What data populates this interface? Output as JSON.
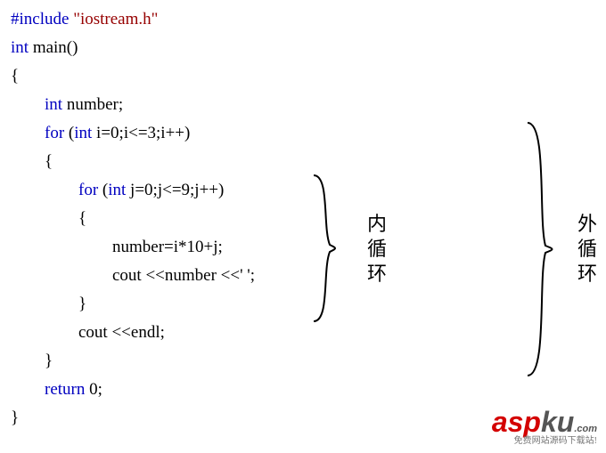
{
  "code": {
    "l1_pp": "#include",
    "l1_str": " \"iostream.h\"",
    "l2_kw": "int",
    "l2_txt": " main()",
    "l3": "{",
    "l4_kw": "int",
    "l4_txt": " number;",
    "l5_kw1": "for",
    "l5_txt1": " (",
    "l5_kw2": "int",
    "l5_txt2": " i=0;i<=3;i++)",
    "l6": "{",
    "l7_kw1": "for",
    "l7_txt1": " (",
    "l7_kw2": "int",
    "l7_txt2": " j=0;j<=9;j++)",
    "l8": "{",
    "l9": "number=i*10+j;",
    "l10": "cout <<number <<' ';",
    "l11": "}",
    "l12": "cout <<endl;",
    "l13": "}",
    "l14_kw": "return",
    "l14_txt": " 0;",
    "l15": "}"
  },
  "labels": {
    "inner": "内循环",
    "outer": "外循环"
  },
  "watermark": {
    "brand_red": "asp",
    "brand_gray": "ku",
    "dot_com": ".com",
    "sub": "免费网站源码下载站!"
  }
}
